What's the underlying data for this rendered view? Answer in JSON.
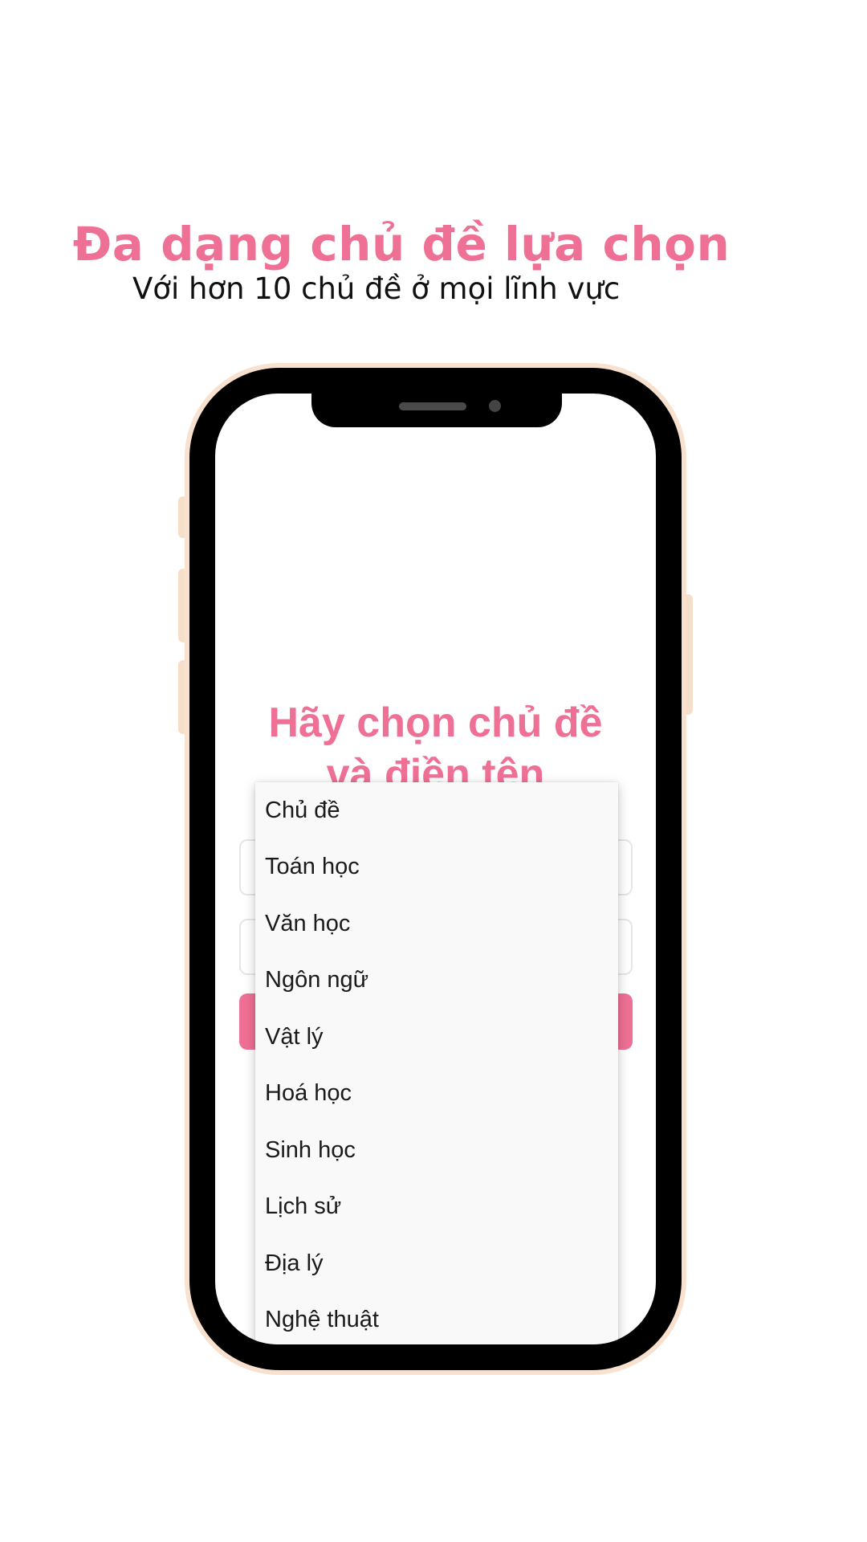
{
  "promo": {
    "headline": "Đa dạng chủ đề lựa chọn",
    "subline": "Với hơn 10 chủ đề ở mọi lĩnh vực"
  },
  "app": {
    "title_line1": "Hãy chọn chủ đề",
    "title_line2": "và điền tên"
  },
  "dropdown": {
    "options": [
      "Chủ đề",
      "Toán học",
      "Văn học",
      "Ngôn ngữ",
      "Vật lý",
      "Hoá học",
      "Sinh học",
      "Lịch sử",
      "Địa lý",
      "Nghệ thuật"
    ]
  },
  "colors": {
    "accent": "#ef7095",
    "phone_frame": "#f8e2cf",
    "phone_body": "#000000",
    "dropdown_bg": "#f9f9f9"
  }
}
